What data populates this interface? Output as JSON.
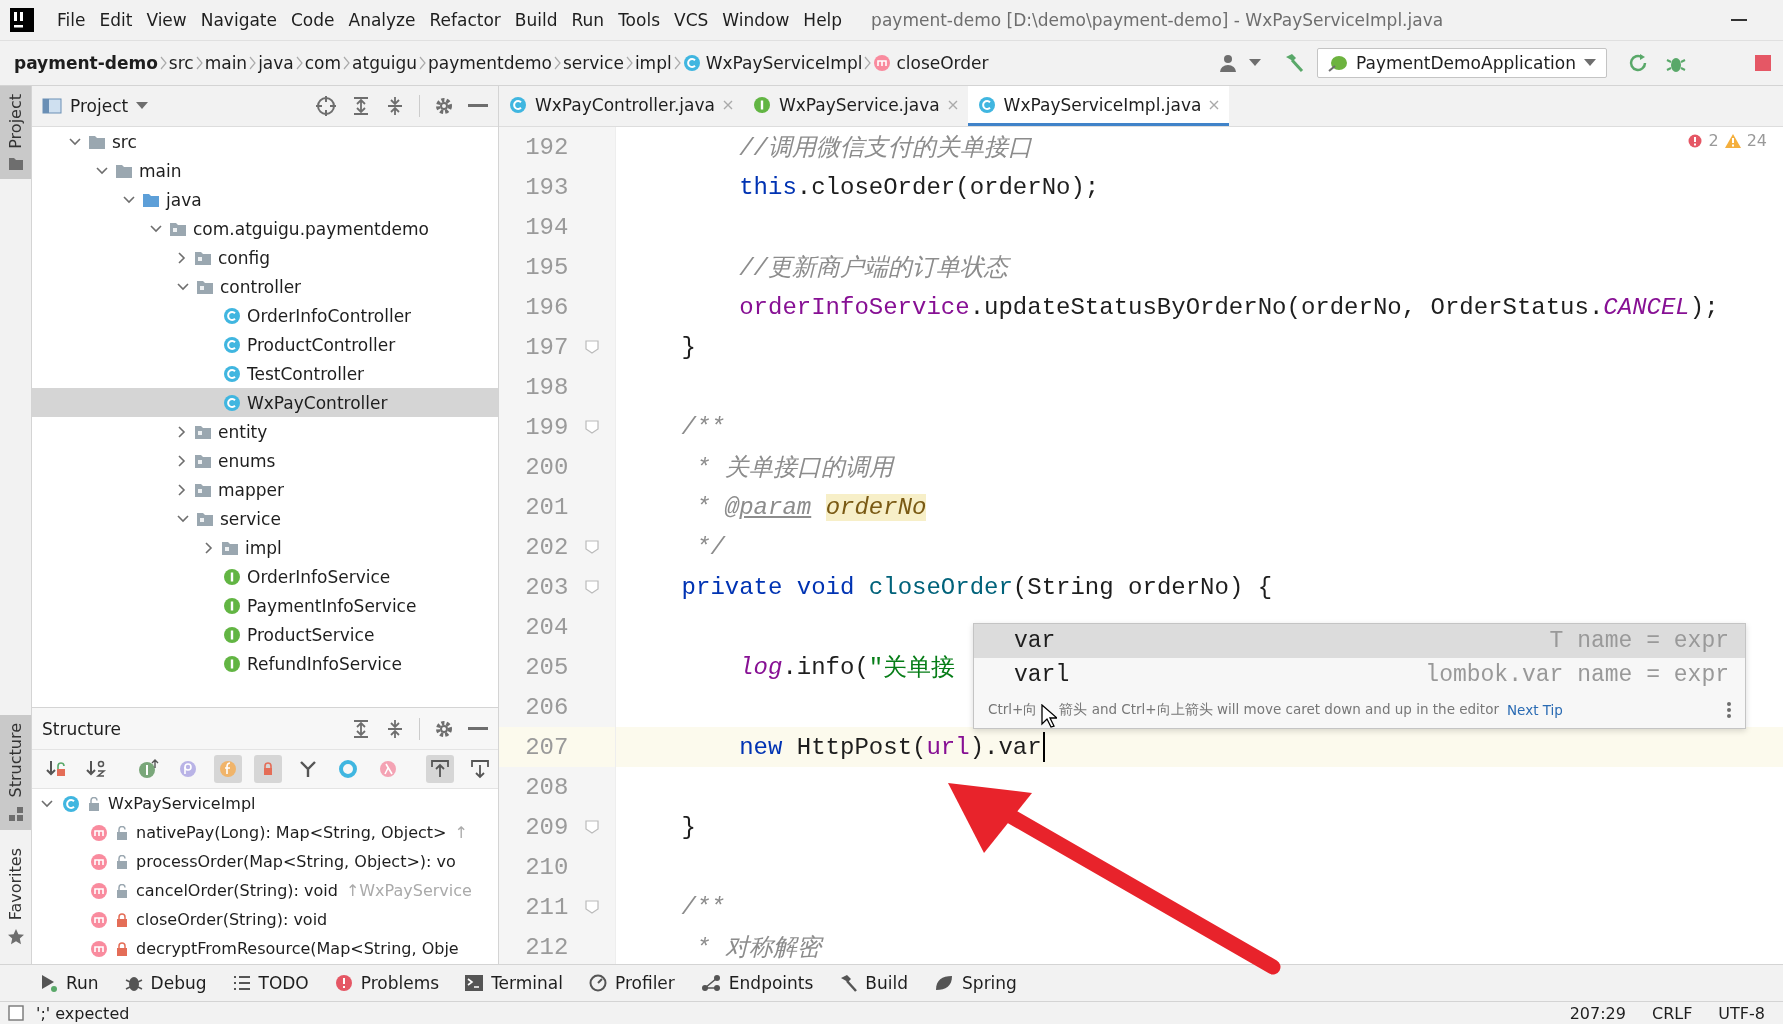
{
  "window": {
    "title": "payment-demo [D:\\demo\\payment-demo] - WxPayServiceImpl.java"
  },
  "menu": [
    "File",
    "Edit",
    "View",
    "Navigate",
    "Code",
    "Analyze",
    "Refactor",
    "Build",
    "Run",
    "Tools",
    "VCS",
    "Window",
    "Help"
  ],
  "breadcrumbs": [
    {
      "label": "payment-demo",
      "kind": "project"
    },
    {
      "label": "src",
      "kind": "dir"
    },
    {
      "label": "main",
      "kind": "dir"
    },
    {
      "label": "java",
      "kind": "dir"
    },
    {
      "label": "com",
      "kind": "dir"
    },
    {
      "label": "atguigu",
      "kind": "dir"
    },
    {
      "label": "paymentdemo",
      "kind": "dir"
    },
    {
      "label": "service",
      "kind": "dir"
    },
    {
      "label": "impl",
      "kind": "dir"
    },
    {
      "label": "WxPayServiceImpl",
      "kind": "class"
    },
    {
      "label": "closeOrder",
      "kind": "method"
    }
  ],
  "run_config": {
    "label": "PaymentDemoApplication"
  },
  "side_stripe": [
    {
      "label": "Project",
      "kind": "project",
      "selected": true
    },
    {
      "label": "Structure",
      "kind": "structure",
      "selected": true
    },
    {
      "label": "Favorites",
      "kind": "favorites",
      "selected": false
    }
  ],
  "project_panel": {
    "title": "Project",
    "tree": [
      {
        "label": "src",
        "kind": "folder",
        "expanded": true,
        "selected": false,
        "children": [
          {
            "label": "main",
            "kind": "folder",
            "expanded": true,
            "selected": false,
            "children": [
              {
                "label": "java",
                "kind": "source-root",
                "expanded": true,
                "selected": false,
                "children": [
                  {
                    "label": "com.atguigu.paymentdemo",
                    "kind": "package",
                    "expanded": true,
                    "selected": false,
                    "children": [
                      {
                        "label": "config",
                        "kind": "package",
                        "expanded": false,
                        "selected": false
                      },
                      {
                        "label": "controller",
                        "kind": "package",
                        "expanded": true,
                        "selected": false,
                        "children": [
                          {
                            "label": "OrderInfoController",
                            "kind": "class",
                            "selected": false
                          },
                          {
                            "label": "ProductController",
                            "kind": "class",
                            "selected": false
                          },
                          {
                            "label": "TestController",
                            "kind": "class",
                            "selected": false
                          },
                          {
                            "label": "WxPayController",
                            "kind": "class",
                            "selected": true
                          }
                        ]
                      },
                      {
                        "label": "entity",
                        "kind": "package",
                        "expanded": false,
                        "selected": false
                      },
                      {
                        "label": "enums",
                        "kind": "package",
                        "expanded": false,
                        "selected": false
                      },
                      {
                        "label": "mapper",
                        "kind": "package",
                        "expanded": false,
                        "selected": false
                      },
                      {
                        "label": "service",
                        "kind": "package",
                        "expanded": true,
                        "selected": false,
                        "children": [
                          {
                            "label": "impl",
                            "kind": "package",
                            "expanded": false,
                            "selected": false
                          },
                          {
                            "label": "OrderInfoService",
                            "kind": "interface",
                            "selected": false
                          },
                          {
                            "label": "PaymentInfoService",
                            "kind": "interface",
                            "selected": false
                          },
                          {
                            "label": "ProductService",
                            "kind": "interface",
                            "selected": false
                          },
                          {
                            "label": "RefundInfoService",
                            "kind": "interface",
                            "selected": false
                          }
                        ]
                      }
                    ]
                  }
                ]
              }
            ]
          }
        ]
      }
    ]
  },
  "editor_tabs": [
    {
      "label": "WxPayController.java",
      "kind": "class",
      "selected": false
    },
    {
      "label": "WxPayService.java",
      "kind": "interface",
      "selected": false
    },
    {
      "label": "WxPayServiceImpl.java",
      "kind": "class",
      "selected": true
    }
  ],
  "inspections": {
    "errors": "2",
    "warnings": "24"
  },
  "code_lines": [
    {
      "number": "192",
      "current": false,
      "fold": false,
      "tokens": [
        {
          "text": "        //调用微信支付的关单接口",
          "kind": "comment"
        }
      ]
    },
    {
      "number": "193",
      "current": false,
      "fold": false,
      "tokens": [
        {
          "text": "        this",
          "kind": "keyword"
        },
        {
          "text": ".closeOrder(orderNo);",
          "kind": "plain"
        }
      ]
    },
    {
      "number": "194",
      "current": false,
      "fold": false
    },
    {
      "number": "195",
      "current": false,
      "fold": false,
      "tokens": [
        {
          "text": "        //更新商户端的订单状态",
          "kind": "comment"
        }
      ]
    },
    {
      "number": "196",
      "current": false,
      "fold": false,
      "tokens": [
        {
          "text": "        orderInfoService",
          "kind": "field"
        },
        {
          "text": ".updateStatusByOrderNo(orderNo, OrderStatus.",
          "kind": "plain"
        },
        {
          "text": "CANCEL",
          "kind": "static"
        },
        {
          "text": ");",
          "kind": "plain"
        }
      ]
    },
    {
      "number": "197",
      "current": false,
      "fold": true,
      "tokens": [
        {
          "text": "    }",
          "kind": "plain"
        }
      ]
    },
    {
      "number": "198",
      "current": false,
      "fold": false
    },
    {
      "number": "199",
      "current": false,
      "fold": true,
      "tokens": [
        {
          "text": "    /**",
          "kind": "doc"
        }
      ]
    },
    {
      "number": "200",
      "current": false,
      "fold": false,
      "tokens": [
        {
          "text": "     * 关单接口的调用",
          "kind": "doc"
        }
      ]
    },
    {
      "number": "201",
      "current": false,
      "fold": false,
      "tokens": [
        {
          "text": "     * ",
          "kind": "doc"
        },
        {
          "text": "@param",
          "kind": "doc-tag"
        },
        {
          "text": "orderNo",
          "kind": "doc-param"
        }
      ]
    },
    {
      "number": "202",
      "current": false,
      "fold": true,
      "tokens": [
        {
          "text": "     */",
          "kind": "doc"
        }
      ]
    },
    {
      "number": "203",
      "current": false,
      "fold": true,
      "tokens": [
        {
          "text": "    private void ",
          "kind": "keyword"
        },
        {
          "text": "closeOrder",
          "kind": "method-decl"
        },
        {
          "text": "(String orderNo) {",
          "kind": "plain"
        }
      ]
    },
    {
      "number": "204",
      "current": false,
      "fold": false
    },
    {
      "number": "205",
      "current": false,
      "fold": false,
      "tokens": [
        {
          "text": "        log",
          "kind": "static"
        },
        {
          "text": ".info(",
          "kind": "plain"
        },
        {
          "text": "\"关单接",
          "kind": "string"
        }
      ]
    },
    {
      "number": "206",
      "current": false,
      "fold": false
    },
    {
      "number": "207",
      "current": true,
      "fold": false,
      "caret": true,
      "tokens": [
        {
          "text": "        new",
          "kind": "keyword"
        },
        {
          "text": " HttpPost(",
          "kind": "plain"
        },
        {
          "text": "url",
          "kind": "field"
        },
        {
          "text": ").var",
          "kind": "plain"
        }
      ]
    },
    {
      "number": "208",
      "current": false,
      "fold": false
    },
    {
      "number": "209",
      "current": false,
      "fold": true,
      "tokens": [
        {
          "text": "    }",
          "kind": "plain"
        }
      ]
    },
    {
      "number": "210",
      "current": false,
      "fold": false
    },
    {
      "number": "211",
      "current": false,
      "fold": true,
      "tokens": [
        {
          "text": "    /**",
          "kind": "doc"
        }
      ]
    },
    {
      "number": "212",
      "current": false,
      "fold": false,
      "tokens": [
        {
          "text": "     * 对称解密",
          "kind": "doc"
        }
      ]
    }
  ],
  "completion": {
    "items": [
      {
        "name": "var",
        "hint": "T name = expr",
        "selected": true
      },
      {
        "name": "varl",
        "hint": "lombok.var name = expr",
        "selected": false
      }
    ],
    "tip": [
      "Ctrl+向",
      "箭头 and Ctrl+向上箭头 will move caret down and up in the editor"
    ],
    "link": "Next Tip"
  },
  "structure_panel": {
    "title": "Structure",
    "filters": [
      {
        "kind": "sort-visibility",
        "on": false
      },
      {
        "kind": "sort-alpha",
        "on": false
      },
      {
        "kind": "inherited",
        "on": false
      },
      {
        "kind": "properties",
        "on": false
      },
      {
        "kind": "fields",
        "on": true
      },
      {
        "kind": "non-public",
        "on": true
      },
      {
        "kind": "anonymous",
        "on": false
      },
      {
        "kind": "lambda-ring",
        "on": false
      },
      {
        "kind": "lambdas",
        "on": false
      },
      {
        "kind": "scroll-to-source",
        "on": true
      },
      {
        "kind": "scroll-from-source",
        "on": false
      }
    ],
    "root": {
      "label": "WxPayServiceImpl",
      "expanded": true,
      "members": [
        {
          "label": "nativePay(Long): Map<String, Object>",
          "hint": "↑",
          "private": false
        },
        {
          "label": "processOrder(Map<String, Object>): vo",
          "private": false
        },
        {
          "label": "cancelOrder(String): void",
          "hint": "↑WxPayService",
          "private": false
        },
        {
          "label": "closeOrder(String): void",
          "private": true
        },
        {
          "label": "decryptFromResource(Map<String, Obje",
          "private": true
        }
      ]
    }
  },
  "tool_windows": [
    {
      "label": "Run",
      "kind": "run"
    },
    {
      "label": "Debug",
      "kind": "debug"
    },
    {
      "label": "TODO",
      "kind": "todo"
    },
    {
      "label": "Problems",
      "kind": "problems"
    },
    {
      "label": "Terminal",
      "kind": "terminal"
    },
    {
      "label": "Profiler",
      "kind": "profiler"
    },
    {
      "label": "Endpoints",
      "kind": "endpoints"
    },
    {
      "label": "Build",
      "kind": "build"
    },
    {
      "label": "Spring",
      "kind": "spring"
    }
  ],
  "status_bar": {
    "message": "';' expected",
    "position": "207:29",
    "line_separator": "CRLF",
    "encoding": "UTF-8"
  }
}
